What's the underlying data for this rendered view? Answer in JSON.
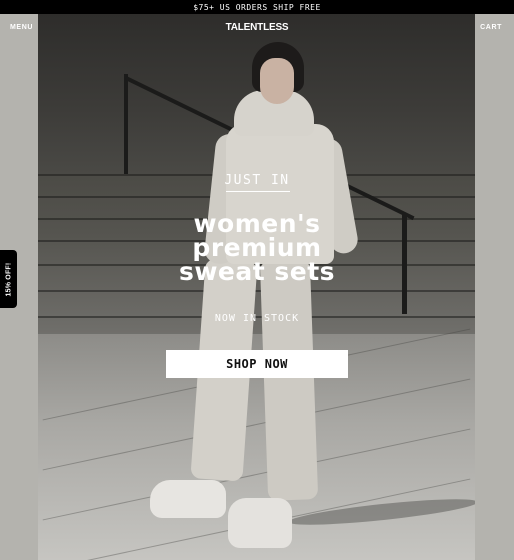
{
  "announcement": "$75+ US ORDERS SHIP FREE",
  "nav": {
    "menu_label": "MENU",
    "brand": "TALENTLESS",
    "cart_label": "CART"
  },
  "promo_tab": "15% OFF!",
  "hero": {
    "eyebrow": "JUST IN",
    "headline_lines": [
      "women's",
      "premium",
      "sweat sets"
    ],
    "subtext": "NOW IN STOCK",
    "cta_label": "SHOP NOW"
  },
  "colors": {
    "announcement_bg": "#000000",
    "page_bg": "#b4b3ae",
    "cta_bg": "#ffffff",
    "text_light": "#ffffff"
  }
}
